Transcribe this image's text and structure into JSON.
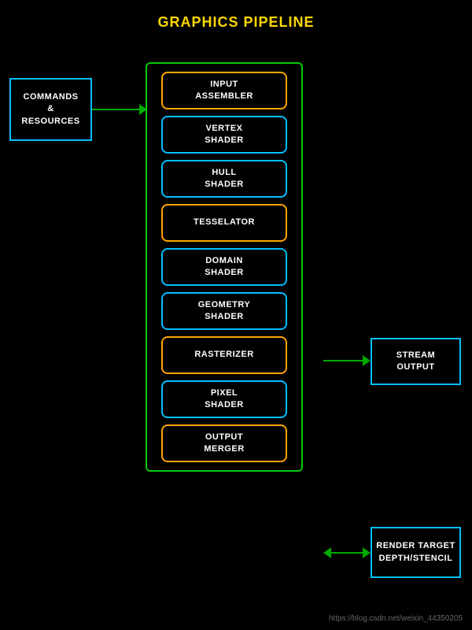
{
  "title": "GRAPHICS PIPELINE",
  "commands": {
    "line1": "COMMANDS",
    "line2": "&",
    "line3": "RESOURCES",
    "full": "COMMANDS\n&\nRESOURCES"
  },
  "stages": [
    {
      "label": "INPUT\nASSEMBLER",
      "type": "orange"
    },
    {
      "label": "VERTEX\nSHADER",
      "type": "blue"
    },
    {
      "label": "HULL\nSHADER",
      "type": "blue"
    },
    {
      "label": "TESSELATOR",
      "type": "orange"
    },
    {
      "label": "DOMAIN\nSHADER",
      "type": "blue"
    },
    {
      "label": "GEOMETRY\nSHADER",
      "type": "blue"
    },
    {
      "label": "RASTERIZER",
      "type": "orange"
    },
    {
      "label": "PIXEL\nSHADER",
      "type": "blue"
    },
    {
      "label": "OUTPUT\nMERGER",
      "type": "orange"
    }
  ],
  "stream_output": {
    "line1": "STREAM",
    "line2": "OUTPUT"
  },
  "render_target": {
    "line1": "RENDER TARGET",
    "line2": "DEPTH/STENCIL"
  },
  "watermark": "https://blog.csdn.net/weixin_44350205",
  "colors": {
    "title": "#FFD700",
    "pipeline_border": "#00CC00",
    "stage_orange": "#FFA500",
    "stage_blue": "#00BFFF",
    "arrow": "#00AA00",
    "text": "#FFFFFF",
    "bg": "#000000"
  }
}
